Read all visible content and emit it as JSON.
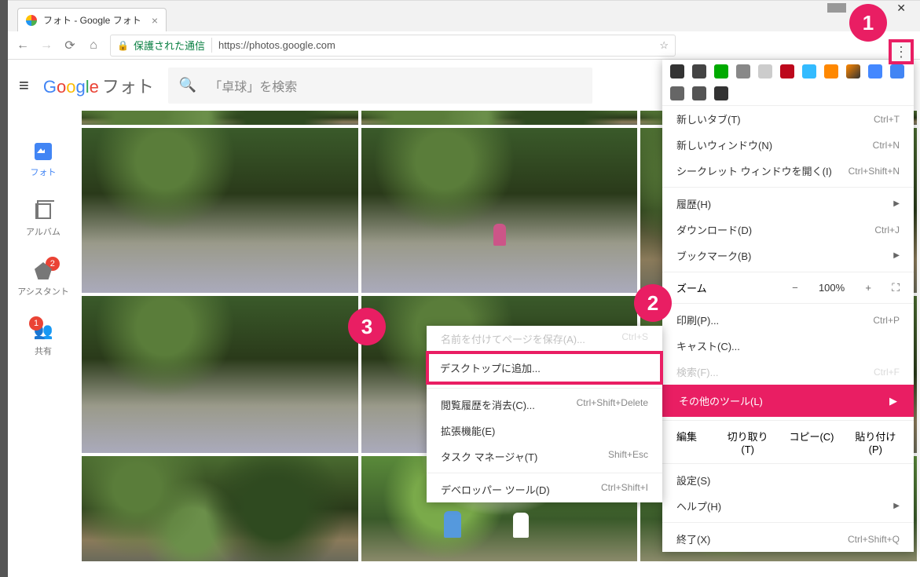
{
  "tab": {
    "title": "フォト - Google フォト"
  },
  "addressbar": {
    "secure_label": "保護された通信",
    "url": "https://photos.google.com"
  },
  "header": {
    "logo_text": "Google",
    "product": "フォト",
    "search_placeholder": "「卓球」を検索"
  },
  "sidebar": {
    "photos": "フォト",
    "album": "アルバム",
    "assistant": "アシスタント",
    "assistant_badge": "2",
    "share": "共有",
    "share_badge": "1"
  },
  "chrome_menu": {
    "new_tab": "新しいタブ(T)",
    "new_tab_sc": "Ctrl+T",
    "new_window": "新しいウィンドウ(N)",
    "new_window_sc": "Ctrl+N",
    "incognito": "シークレット ウィンドウを開く(I)",
    "incognito_sc": "Ctrl+Shift+N",
    "history": "履歴(H)",
    "downloads": "ダウンロード(D)",
    "downloads_sc": "Ctrl+J",
    "bookmarks": "ブックマーク(B)",
    "zoom_label": "ズーム",
    "zoom_minus": "−",
    "zoom_value": "100%",
    "zoom_plus": "+",
    "print": "印刷(P)...",
    "print_sc": "Ctrl+P",
    "cast": "キャスト(C)...",
    "find": "検索(F)...",
    "find_sc": "Ctrl+F",
    "more_tools": "その他のツール(L)",
    "edit_label": "編集",
    "cut": "切り取り(T)",
    "copy": "コピー(C)",
    "paste": "貼り付け(P)",
    "settings": "設定(S)",
    "help": "ヘルプ(H)",
    "exit": "終了(X)",
    "exit_sc": "Ctrl+Shift+Q"
  },
  "submenu": {
    "save_page": "名前を付けてページを保存(A)...",
    "save_page_sc": "Ctrl+S",
    "add_desktop": "デスクトップに追加...",
    "clear_history": "閲覧履歴を消去(C)...",
    "clear_history_sc": "Ctrl+Shift+Delete",
    "extensions": "拡張機能(E)",
    "task_manager": "タスク マネージャ(T)",
    "task_manager_sc": "Shift+Esc",
    "dev_tools": "デベロッパー ツール(D)",
    "dev_tools_sc": "Ctrl+Shift+I"
  },
  "annotations": {
    "n1": "1",
    "n2": "2",
    "n3": "3"
  }
}
